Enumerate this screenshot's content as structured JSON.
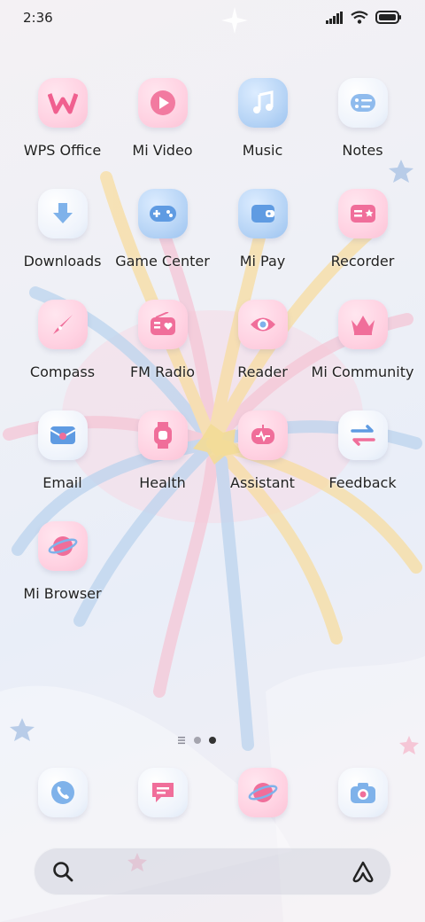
{
  "status": {
    "time": "2:36"
  },
  "apps": [
    {
      "label": "WPS Office",
      "icon": "wps-office-icon",
      "style": "pink"
    },
    {
      "label": "Mi Video",
      "icon": "mi-video-icon",
      "style": "pink"
    },
    {
      "label": "Music",
      "icon": "music-icon",
      "style": "blue"
    },
    {
      "label": "Notes",
      "icon": "notes-icon",
      "style": "white"
    },
    {
      "label": "Downloads",
      "icon": "downloads-icon",
      "style": "white"
    },
    {
      "label": "Game Center",
      "icon": "game-center-icon",
      "style": "blue"
    },
    {
      "label": "Mi Pay",
      "icon": "mi-pay-icon",
      "style": "blue"
    },
    {
      "label": "Recorder",
      "icon": "recorder-icon",
      "style": "pink"
    },
    {
      "label": "Compass",
      "icon": "compass-icon",
      "style": "pink"
    },
    {
      "label": "FM Radio",
      "icon": "fm-radio-icon",
      "style": "pink"
    },
    {
      "label": "Reader",
      "icon": "reader-icon",
      "style": "pink"
    },
    {
      "label": "Mi Community",
      "icon": "mi-community-icon",
      "style": "pink"
    },
    {
      "label": "Email",
      "icon": "email-icon",
      "style": "white"
    },
    {
      "label": "Health",
      "icon": "health-icon",
      "style": "pink"
    },
    {
      "label": "Assistant",
      "icon": "assistant-icon",
      "style": "pink"
    },
    {
      "label": "Feedback",
      "icon": "feedback-icon",
      "style": "white"
    },
    {
      "label": "Mi Browser",
      "icon": "mi-browser-icon",
      "style": "pink"
    }
  ],
  "dock": [
    {
      "icon": "phone-icon",
      "style": "white"
    },
    {
      "icon": "messages-icon",
      "style": "white"
    },
    {
      "icon": "browser-icon",
      "style": "pink"
    },
    {
      "icon": "camera-icon",
      "style": "white"
    }
  ],
  "pager": {
    "pages": 3,
    "current": 3
  }
}
